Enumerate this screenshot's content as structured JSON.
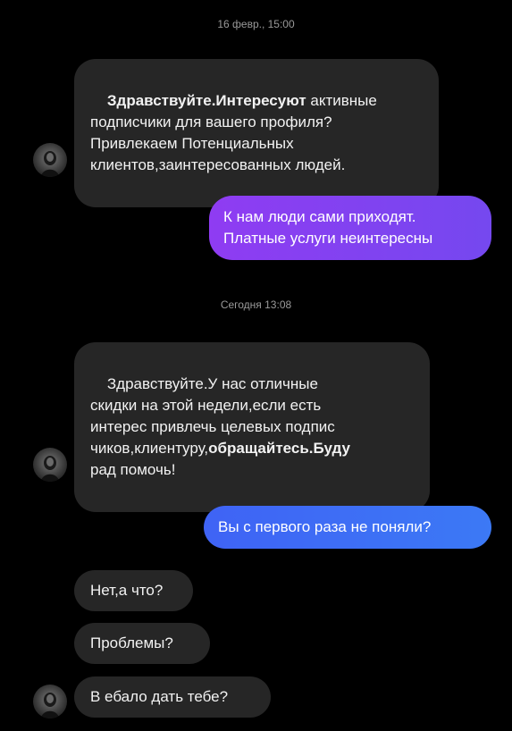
{
  "timestamps": [
    "16 февр., 15:00",
    "Сегодня 13:08"
  ],
  "messages": [
    {
      "segments": [
        {
          "text": "Здравствуйте.Интересуют",
          "bold": true
        },
        {
          "text": " активные\nподписчики для вашего профиля?\nПривлекаем Потенциальных\nклиентов,заинтересованных людей.",
          "bold": false
        }
      ]
    },
    {
      "text": "К нам люди сами приходят.\nПлатные услуги неинтересны"
    },
    {
      "segments": [
        {
          "text": "Здравствуйте.У нас отличные\nскидки на этой недели,если есть\nинтерес привлечь целевых подпис\nчиков,клиентуру,",
          "bold": false
        },
        {
          "text": "обращайтесь.Буду",
          "bold": true
        },
        {
          "text": "\nрад помочь!",
          "bold": false
        }
      ]
    },
    {
      "text": "Вы с первого раза не поняли?"
    },
    {
      "text": "Нет,а что?"
    },
    {
      "text": "Проблемы?"
    },
    {
      "text": "В ебало дать тебе?"
    }
  ],
  "colors": {
    "background": "#000000",
    "incoming_bubble": "#262626",
    "outgoing_purple": "#8f3cf2",
    "outgoing_blue": "#3f63f5",
    "timestamp": "#9a9a9a"
  },
  "icons": {
    "avatar": "avatar-icon"
  }
}
